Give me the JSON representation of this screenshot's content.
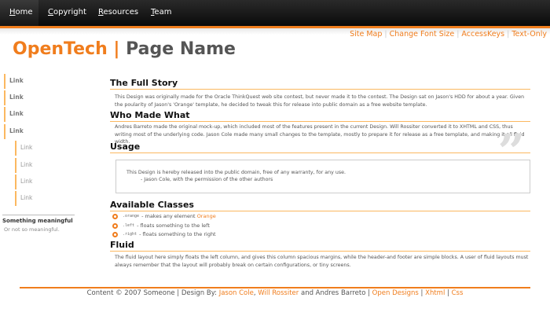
{
  "nav": {
    "items": [
      "Home",
      "Copyright",
      "Resources",
      "Team"
    ]
  },
  "toplinks": [
    "Site Map",
    "Change Font Size",
    "AccessKeys",
    "Text-Only"
  ],
  "title": {
    "brand": "OpenTech",
    "sep": "|",
    "page": "Page Name"
  },
  "sidebar": {
    "links": [
      "Link",
      "Link",
      "Link",
      "Link"
    ],
    "sublinks": [
      "Link",
      "Link",
      "Link",
      "Link"
    ],
    "heading": "Something meaningful",
    "text": "Or not so meaningful."
  },
  "content": {
    "story": {
      "heading": "The Full Story",
      "text": "This Design was originally made for the Oracle ThinkQuest web site contest, but never made it to the contest. The Design sat on Jason's HDD for about a year. Given the poularity of Jason's 'Orange' template, he decided to tweak this for release into public domain as a free website template."
    },
    "who": {
      "heading": "Who Made What",
      "text": "Andres Barreto made the original mock-up, which included most of the features present in the current Design. Will Rossiter converted it to XHTML and CSS, thus writing most of the underlying code. Jason Cole made many small changes to the template, mostly to prepare it for release as a free template, and making it all fluid width."
    },
    "usage": {
      "heading": "Usage",
      "quote": "This Design is hereby released into the public domain, free of any warranty, for any use.",
      "attribution": "- Jason Cole, with the permission of the other authors",
      "quote_mark": "”"
    },
    "classes": {
      "heading": "Available Classes",
      "items": [
        {
          "code": ".orange",
          "text": "- makes any element ",
          "extra": "Orange"
        },
        {
          "code": ".left",
          "text": "- floats something to the left"
        },
        {
          "code": ".right",
          "text": "- floats something to the right"
        }
      ]
    },
    "fluid": {
      "heading": "Fluid",
      "text": "The fluid layout here simply floats the left column, and gives this column spacious margins, while the header-and footer are simple blocks. A user of fluid layouts must always remember that the layout will probably break on certain configurations, or tiny screens."
    }
  },
  "footer": {
    "prefix": "Content © 2007 Someone | Design By: ",
    "a1": "Jason Cole",
    "comma": ", ",
    "a2": "Will Rossiter",
    "mid": " and Andres Barreto | ",
    "l1": "Open Designs",
    "l2": "Xhtml",
    "l3": "Css",
    "sep": " | "
  },
  "colors": {
    "accent": "#f07d1d",
    "nav": "#111111"
  }
}
